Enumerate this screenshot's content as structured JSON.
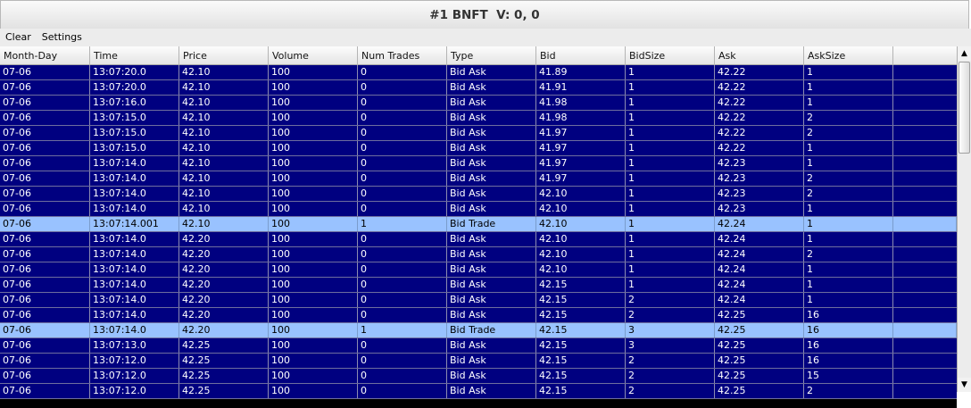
{
  "window": {
    "title": "#1 BNFT  V: 0, 0"
  },
  "menu": {
    "clear": "Clear",
    "settings": "Settings"
  },
  "table": {
    "columns": [
      "Month-Day",
      "Time",
      "Price",
      "Volume",
      "Num Trades",
      "Type",
      "Bid",
      "BidSize",
      "Ask",
      "AskSize",
      ""
    ],
    "rows": [
      {
        "kind": "ask",
        "cells": [
          "07-06",
          "13:07:20.0",
          "42.10",
          "100",
          "0",
          "Bid Ask",
          "41.89",
          "1",
          "42.22",
          "1"
        ]
      },
      {
        "kind": "ask",
        "cells": [
          "07-06",
          "13:07:20.0",
          "42.10",
          "100",
          "0",
          "Bid Ask",
          "41.91",
          "1",
          "42.22",
          "1"
        ]
      },
      {
        "kind": "ask",
        "cells": [
          "07-06",
          "13:07:16.0",
          "42.10",
          "100",
          "0",
          "Bid Ask",
          "41.98",
          "1",
          "42.22",
          "1"
        ]
      },
      {
        "kind": "ask",
        "cells": [
          "07-06",
          "13:07:15.0",
          "42.10",
          "100",
          "0",
          "Bid Ask",
          "41.98",
          "1",
          "42.22",
          "2"
        ]
      },
      {
        "kind": "ask",
        "cells": [
          "07-06",
          "13:07:15.0",
          "42.10",
          "100",
          "0",
          "Bid Ask",
          "41.97",
          "1",
          "42.22",
          "2"
        ]
      },
      {
        "kind": "ask",
        "cells": [
          "07-06",
          "13:07:15.0",
          "42.10",
          "100",
          "0",
          "Bid Ask",
          "41.97",
          "1",
          "42.22",
          "1"
        ]
      },
      {
        "kind": "ask",
        "cells": [
          "07-06",
          "13:07:14.0",
          "42.10",
          "100",
          "0",
          "Bid Ask",
          "41.97",
          "1",
          "42.23",
          "1"
        ]
      },
      {
        "kind": "ask",
        "cells": [
          "07-06",
          "13:07:14.0",
          "42.10",
          "100",
          "0",
          "Bid Ask",
          "41.97",
          "1",
          "42.23",
          "2"
        ]
      },
      {
        "kind": "ask",
        "cells": [
          "07-06",
          "13:07:14.0",
          "42.10",
          "100",
          "0",
          "Bid Ask",
          "42.10",
          "1",
          "42.23",
          "2"
        ]
      },
      {
        "kind": "ask",
        "cells": [
          "07-06",
          "13:07:14.0",
          "42.10",
          "100",
          "0",
          "Bid Ask",
          "42.10",
          "1",
          "42.23",
          "1"
        ]
      },
      {
        "kind": "trade",
        "cells": [
          "07-06",
          "13:07:14.001",
          "42.10",
          "100",
          "1",
          "Bid Trade",
          "42.10",
          "1",
          "42.24",
          "1"
        ]
      },
      {
        "kind": "ask",
        "cells": [
          "07-06",
          "13:07:14.0",
          "42.20",
          "100",
          "0",
          "Bid Ask",
          "42.10",
          "1",
          "42.24",
          "1"
        ]
      },
      {
        "kind": "ask",
        "cells": [
          "07-06",
          "13:07:14.0",
          "42.20",
          "100",
          "0",
          "Bid Ask",
          "42.10",
          "1",
          "42.24",
          "2"
        ]
      },
      {
        "kind": "ask",
        "cells": [
          "07-06",
          "13:07:14.0",
          "42.20",
          "100",
          "0",
          "Bid Ask",
          "42.10",
          "1",
          "42.24",
          "1"
        ]
      },
      {
        "kind": "ask",
        "cells": [
          "07-06",
          "13:07:14.0",
          "42.20",
          "100",
          "0",
          "Bid Ask",
          "42.15",
          "1",
          "42.24",
          "1"
        ]
      },
      {
        "kind": "ask",
        "cells": [
          "07-06",
          "13:07:14.0",
          "42.20",
          "100",
          "0",
          "Bid Ask",
          "42.15",
          "2",
          "42.24",
          "1"
        ]
      },
      {
        "kind": "ask",
        "cells": [
          "07-06",
          "13:07:14.0",
          "42.20",
          "100",
          "0",
          "Bid Ask",
          "42.15",
          "2",
          "42.25",
          "16"
        ]
      },
      {
        "kind": "trade",
        "cells": [
          "07-06",
          "13:07:14.0",
          "42.20",
          "100",
          "1",
          "Bid Trade",
          "42.15",
          "3",
          "42.25",
          "16"
        ]
      },
      {
        "kind": "ask",
        "cells": [
          "07-06",
          "13:07:13.0",
          "42.25",
          "100",
          "0",
          "Bid Ask",
          "42.15",
          "3",
          "42.25",
          "16"
        ]
      },
      {
        "kind": "ask",
        "cells": [
          "07-06",
          "13:07:12.0",
          "42.25",
          "100",
          "0",
          "Bid Ask",
          "42.15",
          "2",
          "42.25",
          "16"
        ]
      },
      {
        "kind": "ask",
        "cells": [
          "07-06",
          "13:07:12.0",
          "42.25",
          "100",
          "0",
          "Bid Ask",
          "42.15",
          "2",
          "42.25",
          "15"
        ]
      },
      {
        "kind": "ask",
        "cells": [
          "07-06",
          "13:07:12.0",
          "42.25",
          "100",
          "0",
          "Bid Ask",
          "42.15",
          "2",
          "42.25",
          "2"
        ]
      }
    ]
  },
  "scrollbar": {
    "up_icon": "triangle-up-icon",
    "down_icon": "triangle-down-icon"
  },
  "colors": {
    "ask_row": "#000080",
    "trade_row": "#99c2ff",
    "ask_text": "#ffffff",
    "trade_text": "#000000"
  }
}
